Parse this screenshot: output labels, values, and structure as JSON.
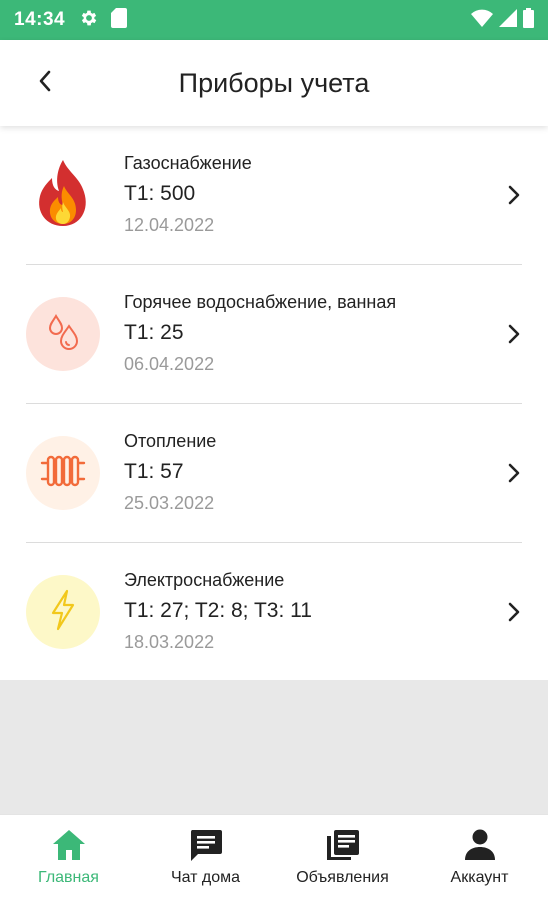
{
  "status_bar": {
    "time": "14:34",
    "icons": [
      "gear-icon",
      "sd-card-icon",
      "wifi-icon",
      "signal-icon",
      "battery-icon"
    ]
  },
  "header": {
    "title": "Приборы учета",
    "back_icon": "chevron-left-icon"
  },
  "meters": [
    {
      "title": "Газоснабжение",
      "value": "T1: 500",
      "date": "12.04.2022",
      "icon": "fire-icon",
      "icon_bg": "#ffffff",
      "accent": "#e53935"
    },
    {
      "title": "Горячее водоснабжение, ванная",
      "value": "T1: 25",
      "date": "06.04.2022",
      "icon": "water-drops-icon",
      "icon_bg": "#fde3dc",
      "accent": "#f26b4f"
    },
    {
      "title": "Отопление",
      "value": "T1: 57",
      "date": "25.03.2022",
      "icon": "radiator-icon",
      "icon_bg": "#fff1e6",
      "accent": "#f26b3a"
    },
    {
      "title": "Электроснабжение",
      "value": "T1: 27; T2: 8; T3: 11",
      "date": "18.03.2022",
      "icon": "lightning-icon",
      "icon_bg": "#fdf8c8",
      "accent": "#f2c81c"
    }
  ],
  "bottom_nav": {
    "items": [
      {
        "label": "Главная",
        "icon": "home-icon",
        "active": true
      },
      {
        "label": "Чат дома",
        "icon": "chat-icon",
        "active": false
      },
      {
        "label": "Объявления",
        "icon": "news-icon",
        "active": false
      },
      {
        "label": "Аккаунт",
        "icon": "account-icon",
        "active": false
      }
    ]
  },
  "colors": {
    "brand": "#3cb878",
    "text": "#222222",
    "secondary_text": "#9a9a9a"
  }
}
